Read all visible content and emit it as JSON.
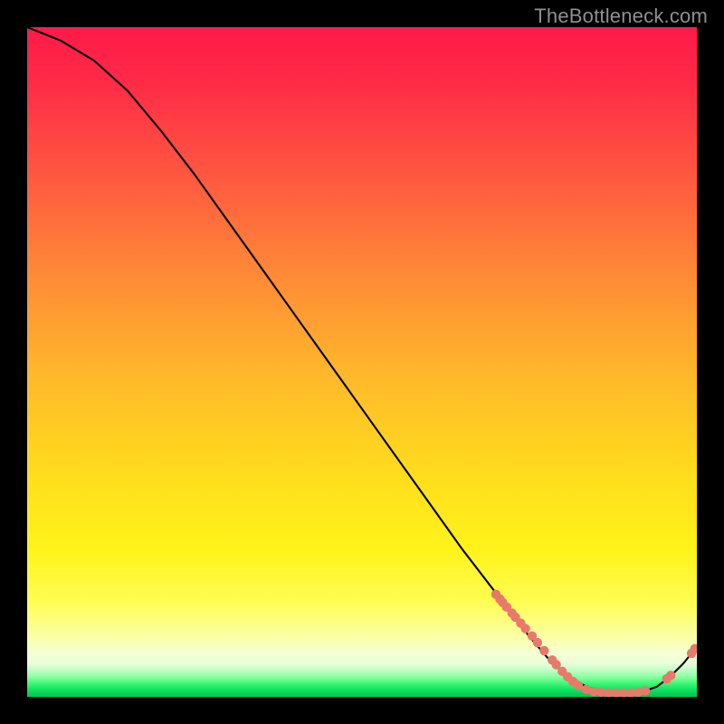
{
  "watermark": "TheBottleneck.com",
  "colors": {
    "page_bg": "#000000",
    "curve_stroke": "#000000",
    "dot_fill": "#e77a6b",
    "gradient_top": "#ff1a49",
    "gradient_mid": "#fff31a",
    "gradient_bottom": "#06c653"
  },
  "chart_data": {
    "type": "line",
    "title": "",
    "xlabel": "",
    "ylabel": "",
    "xlim": [
      0,
      100
    ],
    "ylim": [
      0,
      100
    ],
    "grid": false,
    "legend": false,
    "series": [
      {
        "name": "bottleneck-curve",
        "x": [
          0,
          5,
          10,
          15,
          20,
          25,
          30,
          35,
          40,
          45,
          50,
          55,
          60,
          65,
          70,
          75,
          78,
          80,
          82,
          84,
          86,
          88,
          90,
          92,
          94,
          96,
          98,
          100
        ],
        "values": [
          100,
          98,
          95,
          90.5,
          84.5,
          78,
          71,
          64,
          57,
          50,
          43,
          36,
          29,
          22,
          15.5,
          9,
          5.5,
          3.7,
          2.3,
          1.3,
          0.8,
          0.6,
          0.6,
          0.8,
          1.5,
          3.0,
          5.0,
          7.5
        ]
      }
    ],
    "dot_clusters": [
      {
        "name": "descent-cluster",
        "points": [
          {
            "x": 70.0,
            "y": 15.3
          },
          {
            "x": 70.6,
            "y": 14.6
          },
          {
            "x": 71.0,
            "y": 14.1
          },
          {
            "x": 71.6,
            "y": 13.4
          },
          {
            "x": 72.4,
            "y": 12.5
          },
          {
            "x": 72.9,
            "y": 11.9
          },
          {
            "x": 73.7,
            "y": 11.0
          },
          {
            "x": 74.4,
            "y": 10.2
          },
          {
            "x": 75.4,
            "y": 9.1
          },
          {
            "x": 76.2,
            "y": 8.1
          },
          {
            "x": 77.2,
            "y": 6.9
          },
          {
            "x": 78.4,
            "y": 5.5
          },
          {
            "x": 79.0,
            "y": 4.8
          },
          {
            "x": 79.9,
            "y": 3.8
          },
          {
            "x": 80.7,
            "y": 3.0
          },
          {
            "x": 81.5,
            "y": 2.3
          }
        ]
      },
      {
        "name": "valley-cluster",
        "points": [
          {
            "x": 82.3,
            "y": 1.7
          },
          {
            "x": 83.5,
            "y": 1.1
          },
          {
            "x": 84.6,
            "y": 0.8
          },
          {
            "x": 85.7,
            "y": 0.7
          },
          {
            "x": 86.8,
            "y": 0.6
          },
          {
            "x": 87.9,
            "y": 0.6
          },
          {
            "x": 89.0,
            "y": 0.6
          },
          {
            "x": 90.1,
            "y": 0.6
          },
          {
            "x": 91.2,
            "y": 0.7
          },
          {
            "x": 92.3,
            "y": 0.9
          }
        ]
      },
      {
        "name": "tail-cluster",
        "points": [
          {
            "x": 95.5,
            "y": 2.7
          },
          {
            "x": 96.1,
            "y": 3.2
          },
          {
            "x": 99.2,
            "y": 6.5
          },
          {
            "x": 99.7,
            "y": 7.2
          }
        ]
      }
    ]
  }
}
